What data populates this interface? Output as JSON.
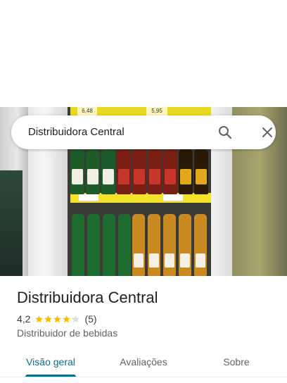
{
  "search": {
    "query": "Distribuidora Central"
  },
  "photo": {
    "price_tags": [
      "6,48",
      "5,95"
    ]
  },
  "place": {
    "title": "Distribuidora Central",
    "rating": "4,2",
    "rating_stars": 4.2,
    "review_count": "(5)",
    "category": "Distribuidor de bebidas"
  },
  "tabs": [
    {
      "label": "Visão geral",
      "active": true
    },
    {
      "label": "Avaliações",
      "active": false
    },
    {
      "label": "Sobre",
      "active": false
    }
  ],
  "colors": {
    "accent": "#0b6e8c",
    "star": "#fbbc04",
    "star_empty": "#dadce0"
  },
  "icons": {
    "search": "search-icon",
    "close": "close-icon",
    "star": "star-icon"
  }
}
